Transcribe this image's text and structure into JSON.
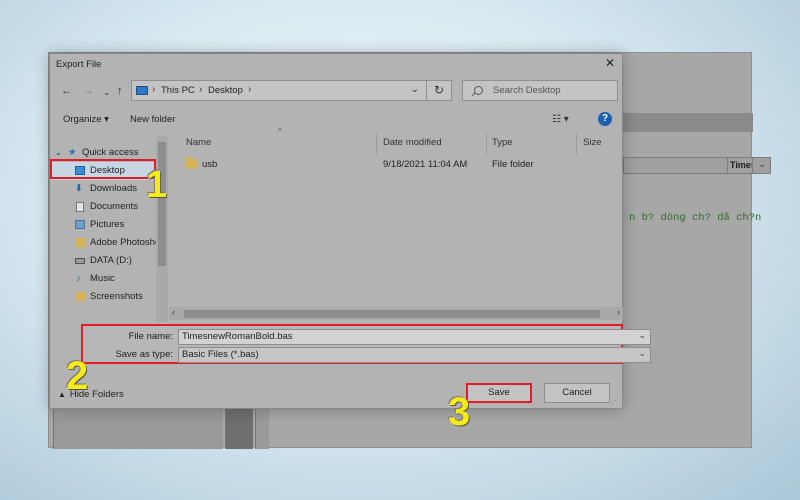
{
  "dialog": {
    "title": "Export File",
    "close_icon": "close-icon"
  },
  "toolbar": {
    "back_icon": "back-arrow-icon",
    "forward_icon": "forward-arrow-icon",
    "recent_icon": "chevron-down-icon",
    "up_icon": "up-arrow-icon"
  },
  "address": {
    "pc_icon": "computer-icon",
    "segments": [
      "This PC",
      "Desktop"
    ],
    "refresh_icon": "refresh-icon"
  },
  "search": {
    "placeholder": "Search Desktop"
  },
  "commands": {
    "organize": "Organize ▾",
    "new_folder": "New folder"
  },
  "nav": {
    "quick_access": "Quick access",
    "items": [
      {
        "label": "Desktop",
        "icon": "desktop-icon",
        "pinned": true,
        "selected": true
      },
      {
        "label": "Downloads",
        "icon": "download-icon",
        "pinned": true
      },
      {
        "label": "Documents",
        "icon": "document-icon",
        "pinned": true
      },
      {
        "label": "Pictures",
        "icon": "picture-icon",
        "pinned": true
      },
      {
        "label": "Adobe Photoshc",
        "icon": "folder-icon"
      },
      {
        "label": "DATA (D:)",
        "icon": "drive-icon"
      },
      {
        "label": "Music",
        "icon": "music-icon"
      },
      {
        "label": "Screenshots",
        "icon": "folder-icon"
      }
    ]
  },
  "columns": {
    "name": "Name",
    "date": "Date modified",
    "type": "Type",
    "size": "Size"
  },
  "files": [
    {
      "name": "usb",
      "date": "9/18/2021 11:04 AM",
      "type": "File folder",
      "icon": "folder-icon"
    }
  ],
  "form": {
    "file_name_label": "File name:",
    "file_name_value": "TimesnewRomanBold.bas",
    "save_type_label": "Save as type:",
    "save_type_value": "Basic Files (*.bas)"
  },
  "footer": {
    "hide_folders": "Hide Folders",
    "save": "Save",
    "cancel": "Cancel"
  },
  "background_app": {
    "font_combo": "Times",
    "code_line": "n b? dòng ch? dã ch?n"
  },
  "steps": [
    "1",
    "2",
    "3"
  ],
  "colors": {
    "highlight": "#e31c2a",
    "step_number": "#f7ea16",
    "help_blue": "#1c5fb3"
  }
}
